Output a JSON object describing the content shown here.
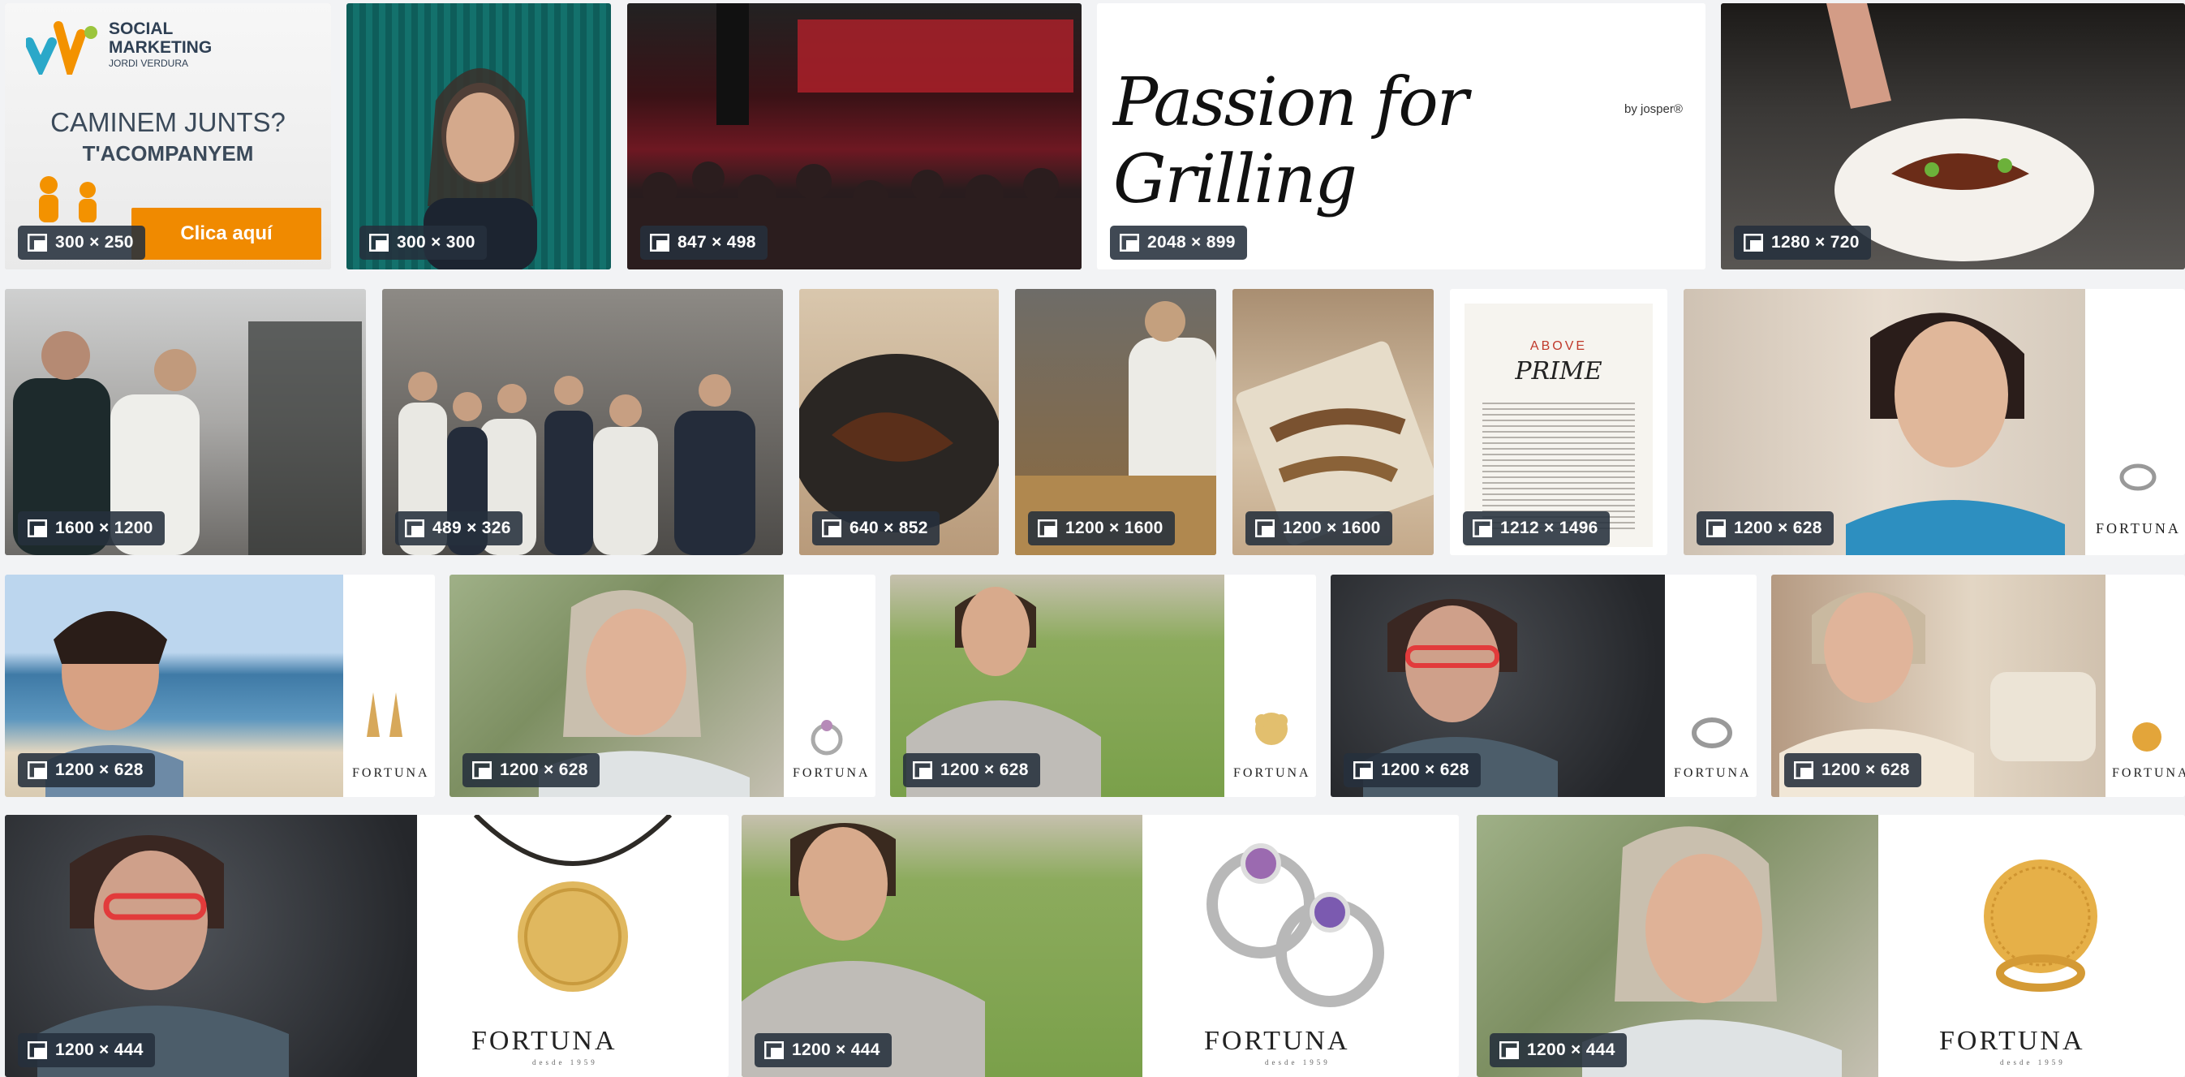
{
  "ad": {
    "brand_line1": "SOCIAL",
    "brand_line2": "MARKETING",
    "brand_line3": "JORDI VERDURA",
    "headline": "CAMINEM JUNTS?",
    "subheadline": "T'ACOMPANYEM",
    "cta": "Clica aquí"
  },
  "passion": {
    "script": "Passion for Grilling",
    "by": "by josper®"
  },
  "article": {
    "kicker": "ABOVE",
    "title": "PRIME"
  },
  "brand": {
    "fortuna": "FORTUNA",
    "fortuna_sub": "desde 1959"
  },
  "tiles": [
    {
      "id": "t1",
      "size": "300 × 250"
    },
    {
      "id": "t2",
      "size": "300 × 300"
    },
    {
      "id": "t3",
      "size": "847 × 498"
    },
    {
      "id": "t4",
      "size": "2048 × 899"
    },
    {
      "id": "t5",
      "size": "1280 × 720"
    },
    {
      "id": "t6",
      "size": "1600 × 1200"
    },
    {
      "id": "t7",
      "size": "489 × 326"
    },
    {
      "id": "t8",
      "size": "640 × 852"
    },
    {
      "id": "t9",
      "size": "1200 × 1600"
    },
    {
      "id": "t10",
      "size": "1200 × 1600"
    },
    {
      "id": "t11",
      "size": "1212 × 1496"
    },
    {
      "id": "t12",
      "size": "1200 × 628"
    },
    {
      "id": "t13",
      "size": "1200 × 628"
    },
    {
      "id": "t14",
      "size": "1200 × 628"
    },
    {
      "id": "t15",
      "size": "1200 × 628"
    },
    {
      "id": "t16",
      "size": "1200 × 628"
    },
    {
      "id": "t17",
      "size": "1200 × 628"
    },
    {
      "id": "t18",
      "size": "1200 × 444"
    },
    {
      "id": "t19",
      "size": "1200 × 444"
    },
    {
      "id": "t20",
      "size": "1200 × 444"
    }
  ]
}
